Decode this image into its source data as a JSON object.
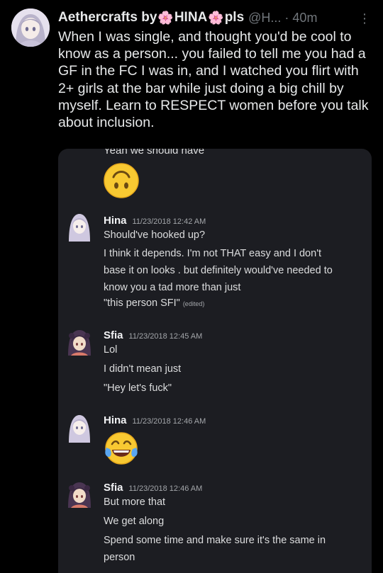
{
  "tweet": {
    "author_name": "Aethercrafts by ",
    "author_flair_left": "🌸",
    "author_flair_name": "HINA",
    "author_flair_right": "🌸",
    "author_suffix": "pls",
    "handle": "@H...",
    "separator": "·",
    "time": "40m",
    "more_icon": "⋮",
    "text": "When I was single, and thought you'd be cool to know as a person... you failed to tell me you had a GF in the FC I was in, and I watched you flirt with 2+ girls at the bar while just doing a big chill by myself. Learn to RESPECT women before you talk about inclusion."
  },
  "embed": {
    "cutoff_text": "Yeah we should have",
    "messages": [
      {
        "user": "Hina",
        "time": "11/23/2018 12:42 AM",
        "lines": [
          "Should've hooked up?",
          "I think it depends. I'm not THAT easy and I don't base it on looks . but definitely would've needed to know you a tad more than just",
          "\"this person SFI\""
        ],
        "edited_label": "(edited)"
      },
      {
        "user": "Sfia",
        "time": "11/23/2018 12:45 AM",
        "lines": [
          "Lol",
          "I didn't mean just",
          "\"Hey let's fuck\""
        ]
      },
      {
        "user": "Hina",
        "time": "11/23/2018 12:46 AM"
      },
      {
        "user": "Sfia",
        "time": "11/23/2018 12:46 AM",
        "lines": [
          "But more that",
          "We get along",
          "Spend some time and make sure it's the same in person"
        ]
      }
    ]
  },
  "colors": {
    "background": "#000000",
    "embed_background": "#1c1d22",
    "muted_text": "#71767b",
    "flair_pink": "#f06ec4"
  }
}
